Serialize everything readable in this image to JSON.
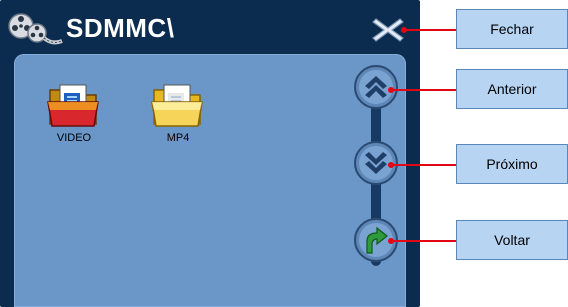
{
  "window": {
    "path": "SDMMC\\"
  },
  "files": [
    {
      "name": "VIDEO",
      "icon": "folder-blue-doc-icon"
    },
    {
      "name": "MP4",
      "icon": "folder-yellow-doc-icon"
    }
  ],
  "controls": {
    "close_icon": "close-x-icon",
    "prev_icon": "double-chevron-up-icon",
    "next_icon": "double-chevron-down-icon",
    "back_icon": "back-arrow-icon"
  },
  "callouts": {
    "close": "Fechar",
    "prev": "Anterior",
    "next": "Próximo",
    "back": "Voltar"
  },
  "colors": {
    "titlebar": "#0b2c4e",
    "panel": "#6a96c8",
    "callout_bg": "#b7d4f3",
    "leader": "#e30613"
  }
}
